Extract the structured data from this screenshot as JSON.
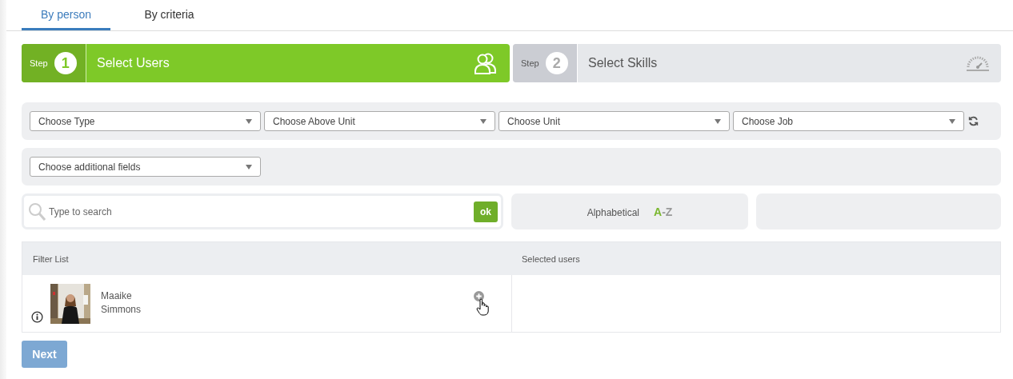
{
  "tabs": [
    {
      "label": "By person",
      "selected": true
    },
    {
      "label": "By criteria",
      "selected": false
    }
  ],
  "steps": [
    {
      "step_label": "Step",
      "number": "1",
      "title": "Select Users",
      "selected": true
    },
    {
      "step_label": "Step",
      "number": "2",
      "title": "Select Skills",
      "selected": false
    }
  ],
  "filters": [
    {
      "placeholder": "Choose Type"
    },
    {
      "placeholder": "Choose Above Unit"
    },
    {
      "placeholder": "Choose Unit"
    },
    {
      "placeholder": "Choose Job"
    }
  ],
  "additional_fields": {
    "placeholder": "Choose additional fields"
  },
  "search": {
    "placeholder": "Type to search",
    "button": "ok"
  },
  "sort": {
    "label": "Alphabetical",
    "from": "A",
    "rest": "-Z"
  },
  "table": {
    "columns": [
      "Filter List",
      "Selected users"
    ],
    "users": [
      {
        "name": "Maaike Simmons",
        "kind": "picture"
      }
    ]
  },
  "next_button": {
    "label": "Next",
    "disabled": true
  }
}
